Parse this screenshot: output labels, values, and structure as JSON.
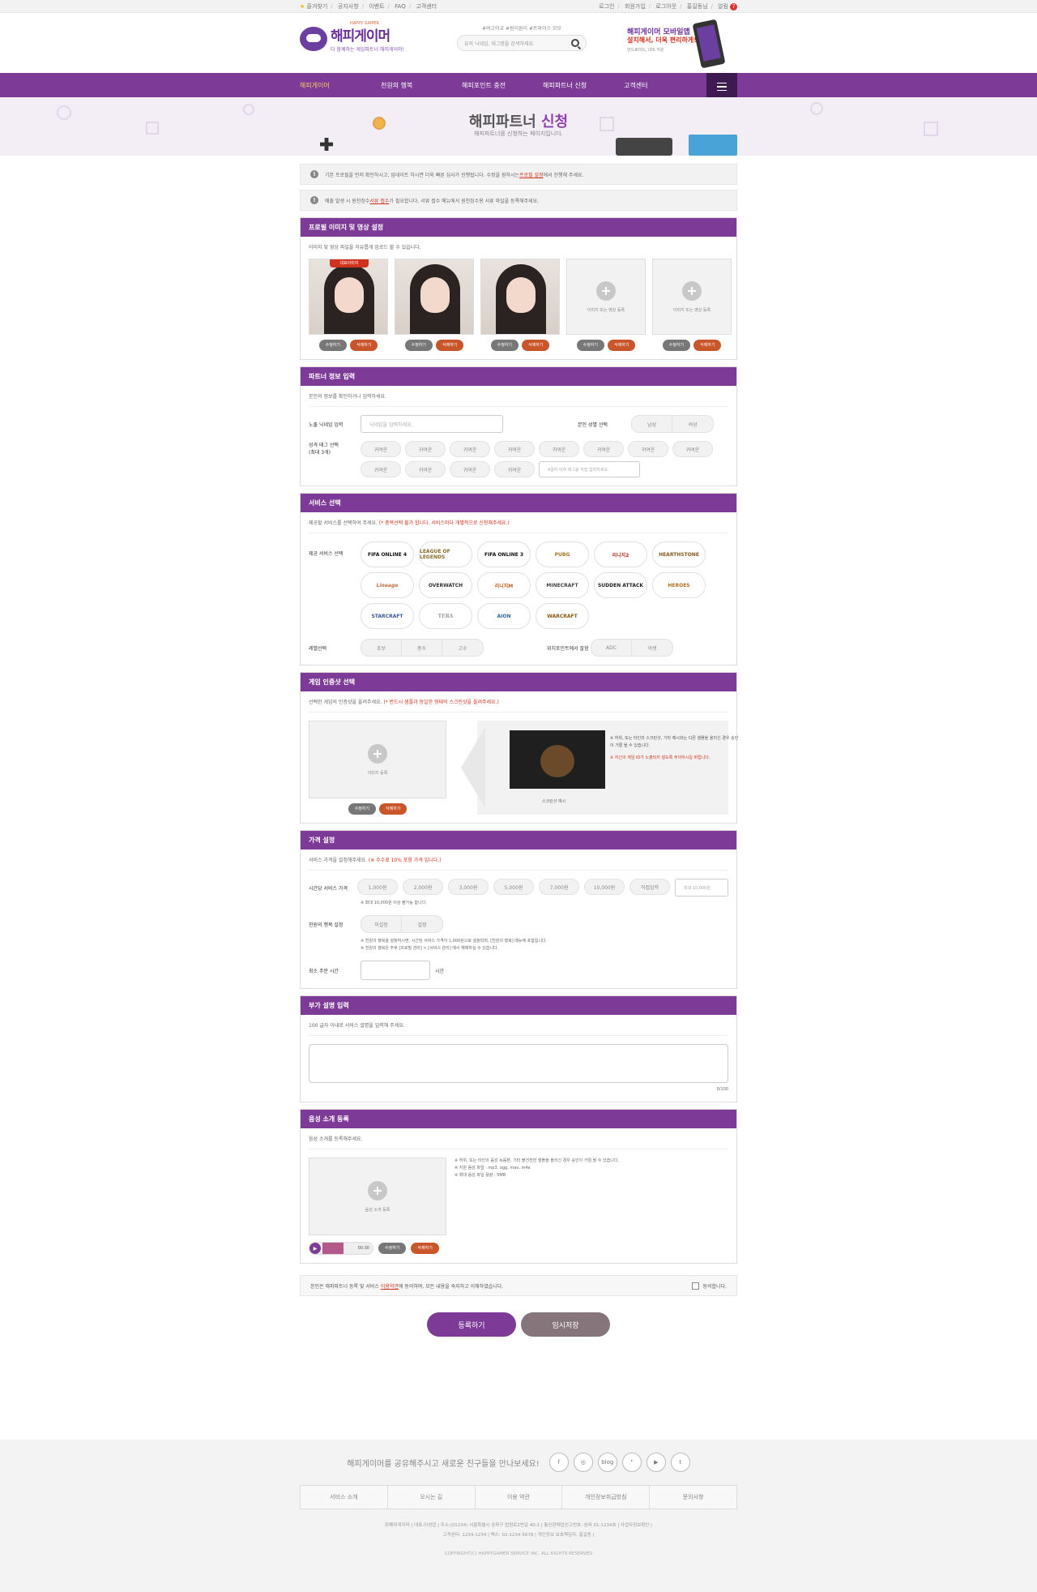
{
  "topbar": {
    "left": [
      "즐겨찾기",
      "공지사항",
      "이벤트",
      "FAQ",
      "고객센터"
    ],
    "right": [
      "로그인",
      "회원가입",
      "로그아웃",
      "홍길동님",
      "알림"
    ],
    "alert_count": "7"
  },
  "logo": {
    "small": "HAPPY GAMER",
    "title": "해피게이머",
    "tagline": "다 함께하는 게임파트너 해피게이머!"
  },
  "search": {
    "tags": "#여고어교 #원이원이 #트와이스 모모",
    "placeholder": "유저 닉네임, 태그명을 검색하세요."
  },
  "promo": {
    "line1": "해피게이머 모바일앱",
    "line2": "설치해서, 더욱 편리하게!",
    "line3": "안드로이드, iOS 지원"
  },
  "nav": {
    "items": [
      "해피게이머",
      "천원의 행복",
      "해피포인트 충전",
      "해피파트너 신청",
      "고객센터"
    ]
  },
  "banner": {
    "title_a": "해피파트너",
    "title_b": "신청",
    "subtitle": "해피파트너를 신청하는 페이지입니다."
  },
  "notes": {
    "n1_a": "기본 프로필을 먼저 확인하시고, 업데이트 하시면 더욱 빠른 심사가 진행됩니다. 수정을 원하시는 ",
    "n1_link": "프로필 설정",
    "n1_b": " 에서 진행해 주세요.",
    "n2_a": "매출 발생 시 원천징수 ",
    "n2_link": "서류 접수",
    "n2_b": "가 필요합니다. 서류 접수 메뉴에서 원천징수용 서류 파일을 등록해주세요."
  },
  "profile": {
    "title": "프로필 이미지 및 영상 설정",
    "desc": "이미지 및 영상 파일을 자유롭게 업로드 할 수 있습니다.",
    "main_tag": "대표이미지",
    "empty_label": "이미지 또는 영상 등록",
    "edit": "수정하기",
    "delete": "삭제하기"
  },
  "partner": {
    "title": "파트너 정보 입력",
    "desc": "본인의 정보를 확인하거나 입력하세요.",
    "nick_label": "노출 닉네임 입력",
    "nick_ph": "닉네임을 입력하세요.",
    "gender_label": "본인 성별 선택",
    "gender": [
      "남성",
      "여성"
    ],
    "tag_label": "성격 태그 선택",
    "tag_sub": "(최대 3개)",
    "tag": "귀여운",
    "tag_input": "4글자 이하 태그를 직접 입력하세요."
  },
  "service": {
    "title": "서비스 선택",
    "desc_a": "제공할 서비스를 선택하여 주세요. ",
    "desc_b": "(* 중복선택 불가 합니다. 서비스마다 개별적으로 신청해주세요.)",
    "game_label": "제공 서비스 선택",
    "games": [
      "FIFA ONLINE 4",
      "LEAGUE OF LEGENDS",
      "FIFA ONLINE 3",
      "PUBG",
      "리니지2",
      "HEARTHSTONE",
      "Lineage",
      "OVERWATCH",
      "리니지M",
      "MINECRAFT",
      "SUDDEN ATTACK",
      "HEROES",
      "STARCRAFT",
      "TERA",
      "AION",
      "WARCRAFT"
    ],
    "level_label": "레벨선택",
    "levels": [
      "초보",
      "중수",
      "고수"
    ],
    "pos_label": "위치포인트에서 잘함",
    "positions": [
      "ADC",
      "정글",
      "서폿",
      "미드",
      "탑"
    ],
    "pos_shown": [
      "ADC",
      "야생"
    ]
  },
  "cert": {
    "title": "게임 인증샷 선택",
    "desc_a": "선택한 게임의 인증샷을 올려주세요. ",
    "desc_b": "(* 반드시 샘플과 동일한 형태의 스크린샷을 올려주세요.)",
    "upload": "이미지 등록",
    "caption": "스크린샷 예시",
    "text1": "※ 허위, 또는 타인의 스크린샷, 기타 예시와는 다른 샘플을 올리신 경우 승인이 거절 될 수 있습니다.",
    "text2": "※ 자신의 게임 ID가 노출되지 않도록 주의하시길 바랍니다.",
    "edit": "수정하기",
    "delete": "삭제하기"
  },
  "price": {
    "title": "가격 설정",
    "desc_a": "서비스 가격을 설정해주세요. ",
    "desc_b": "(※ 수수료 10% 포함 가격 입니다.)",
    "hour_label": "시간당 서비스 가격",
    "options": [
      "1,000원",
      "2,000원",
      "3,000원",
      "5,000원",
      "7,000원",
      "10,000원",
      "직접입력"
    ],
    "custom_ph": "최대 10,000원",
    "note": "※ 최대 10,000원 이상 불가능 합니다.",
    "happy_label": "천원의 행복 설정",
    "happy": [
      "미설정",
      "설정"
    ],
    "happy_note1": "※ 천원의 행복을 설정하시면, 시간당 서비스 가격이 1,000원으로 설정되며, [천원의 행복] 메뉴에 포함됩니다.",
    "happy_note2": "※ 천원의 행복은 추후 [프로필 관리] > [서비스 관리] 에서 해제하실 수 있습니다.",
    "min_label": "최소 주문 시간",
    "min_unit": "시간"
  },
  "extra": {
    "title": "부가 설명 입력",
    "desc": "100 글자 이내로 서비스 설명을 입력해 주세요.",
    "count": "0/100"
  },
  "voice": {
    "title": "음성 소개 등록",
    "desc": "음성 소개를 등록해주세요.",
    "upload": "음성 소개 등록",
    "n1": "※ 허위, 또는 타인의 음성 녹음본, 기타 불건전한 샘플을 올리신 경우 승인이 거절 될 수 있습니다.",
    "n2": "※ 지원 음성 파일 : mp3, ogg, mav, m4a",
    "n3": "※ 최대 음성 파일 용량 : 5MB",
    "time": "00:30",
    "edit": "수정하기",
    "delete": "삭제하기"
  },
  "agree": {
    "text_a": "본인은 해피파트너 등록 및 서비스 ",
    "link": "이용약관",
    "text_b": "에 동의하며, 모든 내용을 숙지하고 이해하였습니다.",
    "check": "동의합니다."
  },
  "actions": {
    "submit": "등록하기",
    "temp": "임시저장"
  },
  "footer": {
    "share": "해피게이머를 공유해주시고 새로운 친구들을 만나보세요!",
    "social": [
      "f",
      "◎",
      "blog",
      "❜",
      "▶",
      "t"
    ],
    "links": [
      "서비스 소개",
      "오시는 길",
      "이용 약관",
      "개인정보취급방침",
      "문의사항"
    ],
    "info1": "㈜해피게이머 | 대표:이성엽 | 주소:(01234) 서울특별시 송파구 법원로2번길 40-1 | 통신판매업신고번호: 송파 01-1234호 | 사업자정보확인 |",
    "info2": "고객센터: 1234-1234 | 팩스: 02-1234-5678 | 개인정보 보호책임자: 홍길동 |",
    "copy": "COPYRIGHT(C) HAPPYGAMER SERVICE INC. ALL RIGHTS RESERVED"
  }
}
